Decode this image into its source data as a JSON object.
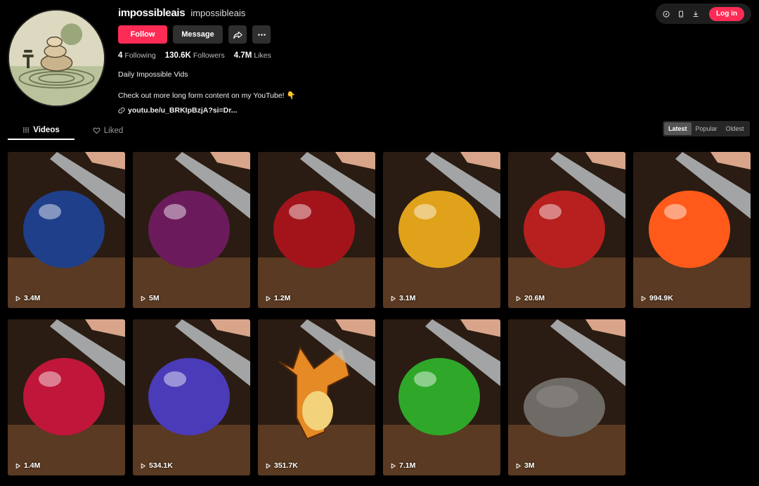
{
  "profile": {
    "username": "impossibleais",
    "nickname": "impossibleais",
    "follow_label": "Follow",
    "message_label": "Message",
    "stats": {
      "following": "4",
      "following_label": "Following",
      "followers": "130.6K",
      "followers_label": "Followers",
      "likes": "4.7M",
      "likes_label": "Likes"
    },
    "bio_line1": "Daily Impossible Vids",
    "bio_line2": "Check out more long form content on my YouTube! 👇",
    "link": "youtu.be/u_BRKIpBzjA?si=Dr..."
  },
  "topbar": {
    "login_label": "Log in"
  },
  "tabs": {
    "videos": "Videos",
    "liked": "Liked"
  },
  "sort": {
    "latest": "Latest",
    "popular": "Popular",
    "oldest": "Oldest"
  },
  "videos": [
    {
      "views": "3.4M",
      "color": "#1f3f8a"
    },
    {
      "views": "5M",
      "color": "#6b1a5c"
    },
    {
      "views": "1.2M",
      "color": "#a3141a"
    },
    {
      "views": "3.1M",
      "color": "#e0a21a"
    },
    {
      "views": "20.6M",
      "color": "#b81f1f"
    },
    {
      "views": "994.9K",
      "color": "#ff5a1a"
    },
    {
      "views": "1.4M",
      "color": "#c0163a"
    },
    {
      "views": "534.1K",
      "color": "#4a3bb8"
    },
    {
      "views": "351.7K",
      "color": "#e58a24"
    },
    {
      "views": "7.1M",
      "color": "#2fa82a"
    },
    {
      "views": "3M",
      "color": "#6e6a66"
    }
  ]
}
